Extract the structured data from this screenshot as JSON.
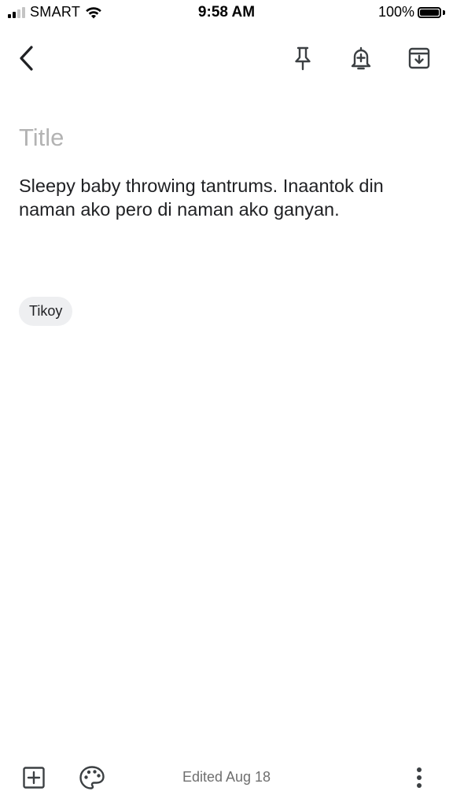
{
  "status_bar": {
    "carrier": "SMART",
    "time": "9:58 AM",
    "battery": "100%",
    "signal_bars_active": 2,
    "signal_bars_total": 4,
    "battery_level": 1.0
  },
  "toolbar": {
    "back_icon": "chevron-left-icon",
    "pin_icon": "pin-icon",
    "reminder_icon": "bell-plus-icon",
    "archive_icon": "archive-icon"
  },
  "note": {
    "title_value": "",
    "title_placeholder": "Title",
    "body": "Sleepy baby throwing tantrums. Inaantok din naman ako pero di naman ako ganyan.",
    "labels": [
      "Tikoy"
    ]
  },
  "bottom_bar": {
    "add_icon": "add-box-icon",
    "palette_icon": "palette-icon",
    "edited": "Edited Aug 18",
    "more_icon": "more-vertical-icon"
  },
  "colors": {
    "text": "#202124",
    "placeholder": "#b3b3b3",
    "chip_bg": "#eeeff1",
    "muted": "#6f6f6f"
  }
}
